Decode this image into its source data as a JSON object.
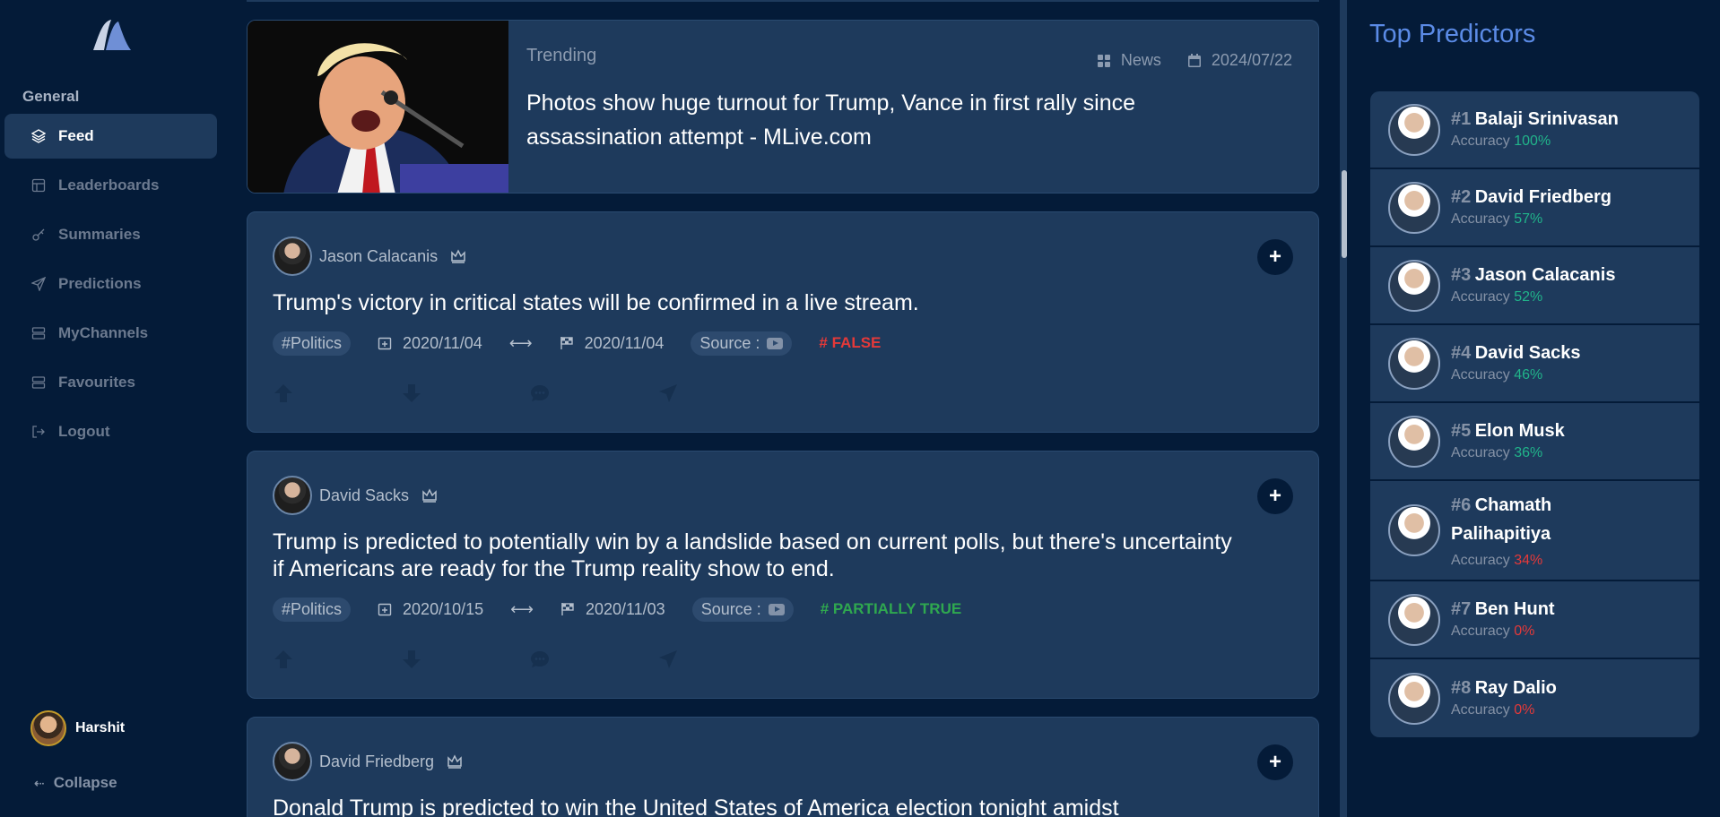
{
  "sidebar": {
    "section": "General",
    "items": [
      {
        "label": "Feed",
        "icon": "layers-icon",
        "active": true
      },
      {
        "label": "Leaderboards",
        "icon": "table-icon"
      },
      {
        "label": "Summaries",
        "icon": "key-icon"
      },
      {
        "label": "Predictions",
        "icon": "send-icon"
      },
      {
        "label": "MyChannels",
        "icon": "server-icon"
      },
      {
        "label": "Favourites",
        "icon": "server-icon"
      },
      {
        "label": "Logout",
        "icon": "logout-icon"
      }
    ],
    "user": {
      "name": "Harshit"
    },
    "collapse": "Collapse"
  },
  "news": {
    "tag": "Trending",
    "category": "News",
    "date": "2024/07/22",
    "title": "Photos show huge turnout for Trump, Vance in first rally since assassination attempt - MLive.com"
  },
  "predictions": [
    {
      "author": "Jason Calacanis",
      "text": "Trump's victory in critical states will be confirmed in a live stream.",
      "tag": "#Politics",
      "start": "2020/11/04",
      "end": "2020/11/04",
      "source": "Source :",
      "verdict": "# FALSE"
    },
    {
      "author": "David Sacks",
      "text": "Trump is predicted to potentially win by a landslide based on current polls, but there's uncertainty if Americans are ready for the Trump reality show to end.",
      "tag": "#Politics",
      "start": "2020/10/15",
      "end": "2020/11/03",
      "source": "Source :",
      "verdict": "# PARTIALLY TRUE"
    },
    {
      "author": "David Friedberg",
      "text": "Donald Trump is predicted to win the United States of America election tonight amidst"
    }
  ],
  "right": {
    "title": "Top Predictors",
    "accuracy_label": "Accuracy",
    "predictors": [
      {
        "rank": "#1",
        "name": "Balaji Srinivasan",
        "accuracy": "100%",
        "status": "good"
      },
      {
        "rank": "#2",
        "name": "David Friedberg",
        "accuracy": "57%",
        "status": "good"
      },
      {
        "rank": "#3",
        "name": "Jason Calacanis",
        "accuracy": "52%",
        "status": "good"
      },
      {
        "rank": "#4",
        "name": "David Sacks",
        "accuracy": "46%",
        "status": "good"
      },
      {
        "rank": "#5",
        "name": "Elon Musk",
        "accuracy": "36%",
        "status": "good"
      },
      {
        "rank": "#6",
        "name": "Chamath Palihapitiya",
        "accuracy": "34%",
        "status": "bad"
      },
      {
        "rank": "#7",
        "name": "Ben Hunt",
        "accuracy": "0%",
        "status": "bad"
      },
      {
        "rank": "#8",
        "name": "Ray Dalio",
        "accuracy": "0%",
        "status": "bad"
      }
    ]
  },
  "colors": {
    "accent": "#5b8be6",
    "good": "#21b48a",
    "bad": "#e53939",
    "partial": "#2fa84f"
  }
}
